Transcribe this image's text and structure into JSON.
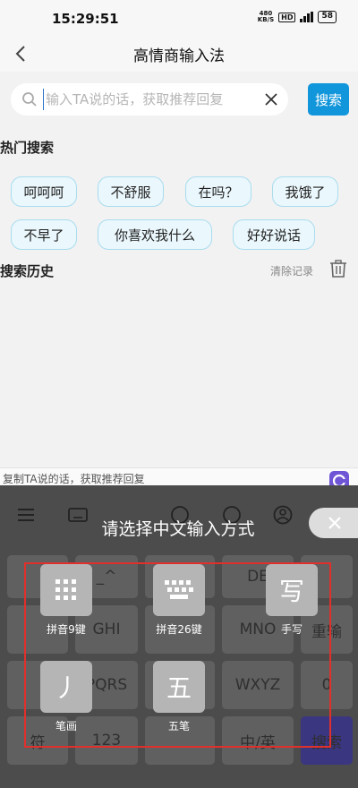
{
  "status_bar": {
    "time": "15:29:51",
    "net_speed_value": "480",
    "net_speed_unit": "KB/S",
    "hd": "HD",
    "battery": "58"
  },
  "header": {
    "title": "高情商输入法"
  },
  "search": {
    "placeholder": "输入TA说的话，获取推荐回复",
    "button_label": "搜索"
  },
  "hot": {
    "title": "热门搜索",
    "items": [
      "呵呵呵",
      "不舒服",
      "在吗？",
      "我饿了",
      "不早了",
      "你喜欢我什么",
      "好好说话"
    ]
  },
  "history": {
    "title": "搜索历史",
    "clear_label": "清除记录"
  },
  "hint_bar": {
    "text": "复制TA说的话，获取推荐回复"
  },
  "keyboard": {
    "keys": [
      "_^",
      "DE",
      "GHI",
      "MNO",
      "重输",
      "PQRS",
      "WXYZ",
      "0",
      "符",
      "123",
      "中/英",
      "搜索"
    ]
  },
  "overlay": {
    "title": "请选择中文输入方式",
    "methods": [
      {
        "label": "拼音9键",
        "icon": "keypad-9-icon"
      },
      {
        "label": "拼音26键",
        "icon": "keyboard-26-icon"
      },
      {
        "label": "手写",
        "icon": "handwriting-icon",
        "glyph": "写"
      },
      {
        "label": "笔画",
        "icon": "stroke-icon",
        "glyph": "丿"
      },
      {
        "label": "五笔",
        "icon": "wubi-icon",
        "glyph": "五"
      }
    ]
  },
  "colors": {
    "accent": "#1296db",
    "highlight_frame": "#e0302c",
    "chip_border": "#a9dcef"
  }
}
